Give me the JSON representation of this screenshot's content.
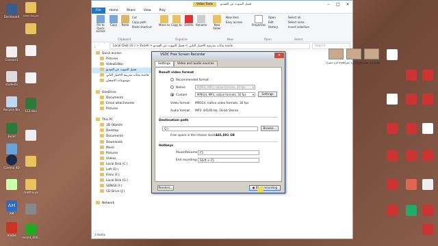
{
  "desktop": {
    "left_icons": [
      "Dashboard",
      "Console1",
      "students",
      "Recycle Bin",
      "Excel",
      "VSDC",
      "Cinema 4D",
      "",
      "AM",
      "Adobe",
      "",
      "record_000..."
    ],
    "left2_icons": [
      "مدرسة محمد",
      "",
      "",
      "",
      "123.xlsx",
      "",
      "",
      "matthiyya",
      "",
      "",
      ""
    ],
    "right_icons": [
      "",
      "",
      "",
      "",
      "",
      "",
      "",
      "",
      "",
      "",
      "",
      ""
    ]
  },
  "explorer": {
    "titlebar": {
      "tool_tab": "Video Tools",
      "path": "فصل الصوت عن الفيديو"
    },
    "tabs": [
      "File",
      "Home",
      "Share",
      "View",
      "Play"
    ],
    "ribbon": {
      "pin_label": "Pin to Quick access",
      "copy_label": "Copy",
      "paste_label": "Paste",
      "cut_label": "Cut",
      "copy_path_label": "Copy path",
      "paste_shortcut_label": "Paste shortcut",
      "move_to_label": "Move to",
      "copy_to_label": "Copy to",
      "delete_label": "Delete",
      "rename_label": "Rename",
      "new_folder_label": "New folder",
      "new_item_label": "New item",
      "easy_access_label": "Easy access",
      "properties_label": "Properties",
      "open_label": "Open",
      "edit_label": "Edit",
      "history_label": "History",
      "select_all_label": "Select all",
      "select_none_label": "Select none",
      "invert_selection_label": "Invert selection",
      "group_clipboard": "Clipboard",
      "group_organize": "Organize",
      "group_new": "New",
      "group_open": "Open",
      "group_select": "Select"
    },
    "address": {
      "crumbs": "Local Disk (G:)  >  Excell  >  قاعدة بيانات مدرسة الاختبار الثاني  >  فصل الصوت عن الفيديو",
      "search": "Search"
    },
    "nav": [
      {
        "label": "Quick access",
        "selected": false
      },
      {
        "label": "Pictures",
        "selected": false
      },
      {
        "label": "VideoEditor",
        "selected": false
      },
      {
        "label": "فصل الصوت عن الفيديو",
        "selected": true
      },
      {
        "label": "قاعدة بيانات مدرسة الاختبار الثاني",
        "selected": false
      },
      {
        "label": "موضوعات الامتحان",
        "selected": false
      },
      {
        "label": "",
        "selected": false
      },
      {
        "label": "OneDrive",
        "selected": false
      },
      {
        "label": "Documents",
        "selected": false
      },
      {
        "label": "Email attachments",
        "selected": false
      },
      {
        "label": "Pictures",
        "selected": false
      },
      {
        "label": "",
        "selected": false
      },
      {
        "label": "This PC",
        "selected": false
      },
      {
        "label": "3D Objects",
        "selected": false
      },
      {
        "label": "Desktop",
        "selected": false
      },
      {
        "label": "Documents",
        "selected": false
      },
      {
        "label": "Downloads",
        "selected": false
      },
      {
        "label": "Music",
        "selected": false
      },
      {
        "label": "Pictures",
        "selected": false
      },
      {
        "label": "Videos",
        "selected": false
      },
      {
        "label": "Local Disk (C:)",
        "selected": false
      },
      {
        "label": "Loft (D:)",
        "selected": false
      },
      {
        "label": "Films (F:)",
        "selected": false
      },
      {
        "label": "Local Disk (G:)",
        "selected": false
      },
      {
        "label": "SONGS (I:)",
        "selected": false
      },
      {
        "label": "CD Drive (J:)",
        "selected": false
      },
      {
        "label": "",
        "selected": false
      },
      {
        "label": "Network",
        "selected": false
      }
    ],
    "files": [
      "كرة خضراء.mp4",
      "كرة حمراء.mp4",
      "كرة خضراء.mp4"
    ],
    "status": "3 items"
  },
  "dialog": {
    "title": "VSDC Free Screen Recorder",
    "tabs": [
      "Settings",
      "Video and audio sources"
    ],
    "result_section": "Result video format",
    "recommended_label": "Recommended format",
    "native_label": "Native",
    "native_value": "MJPEG, MP3, native formats, 30 fps",
    "custom_label": "Custom",
    "custom_value": "MPEG4, MP3, native formats, 30 fps",
    "settings_button": "Settings",
    "video_format_label": "Video format:",
    "video_format_value": "MPEG4, native video formats, 30 fps",
    "audio_format_label": "Audio format:",
    "audio_format_value": "MP3: 44100 Hz, 16-bit Stereo",
    "destination_section": "Destination path",
    "destination_value": "G:\\",
    "browse_button": "Browse...",
    "free_space_label": "Free space in the chosen location:",
    "free_space_value": "121,891 GB",
    "hotkeys_section": "Hotkeys",
    "pause_label": "Pause/Resume:",
    "pause_value": "F5",
    "end_label": "End recording:",
    "end_value": "Shift + F5",
    "renders_button": "Renders...",
    "start_button": "Start recording"
  }
}
